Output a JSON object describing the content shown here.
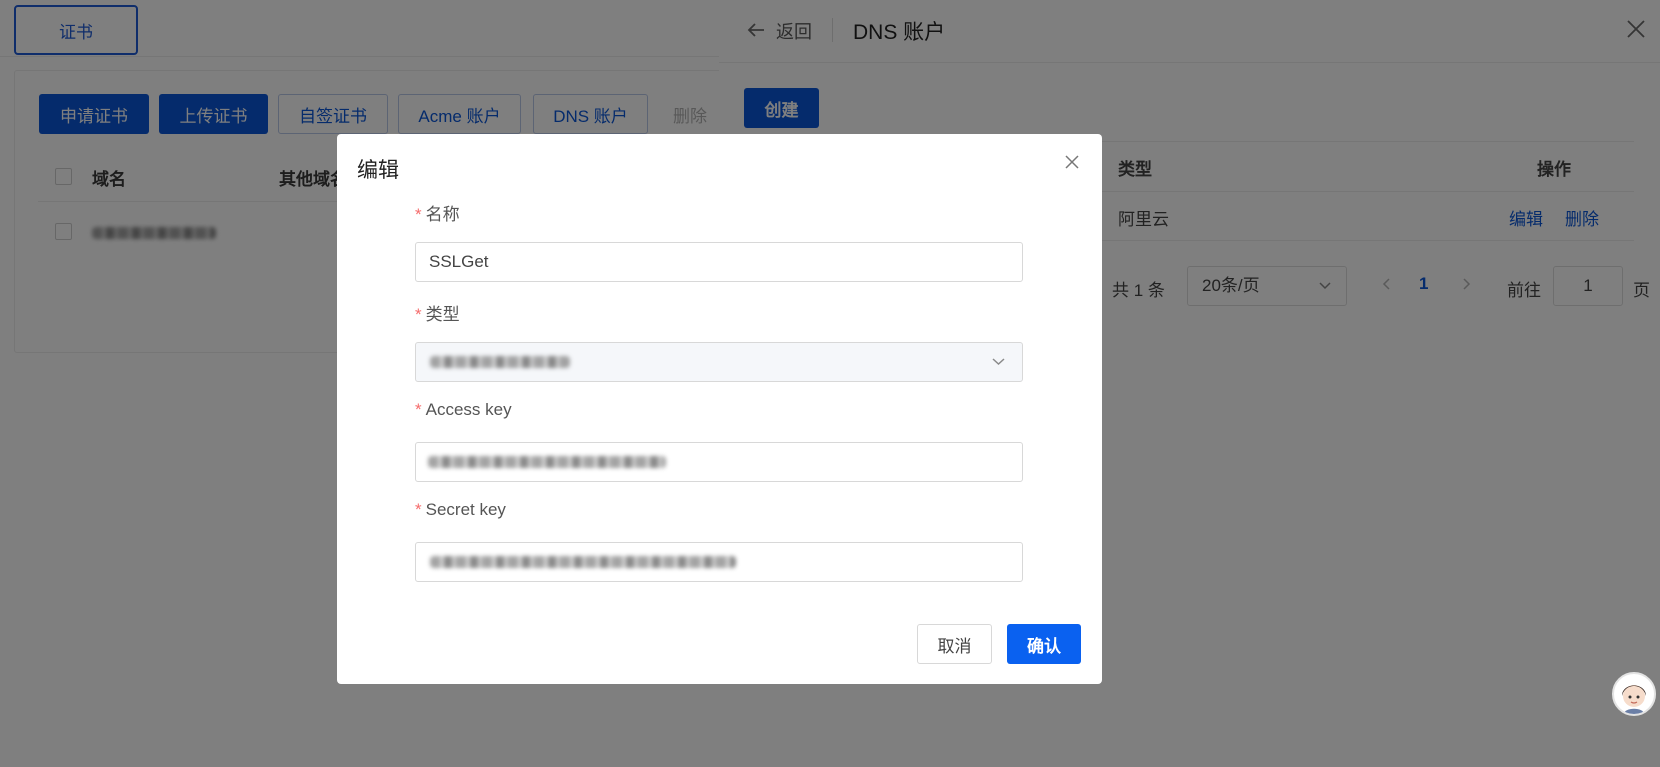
{
  "background": {
    "tab_label": "证书",
    "toolbar": {
      "apply_cert": "申请证书",
      "upload_cert": "上传证书",
      "self_signed": "自签证书",
      "acme_account": "Acme 账户",
      "dns_account": "DNS 账户",
      "delete": "删除"
    },
    "table": {
      "col_domain": "域名",
      "col_other": "其他域名"
    }
  },
  "drawer": {
    "back_label": "返回",
    "title": "DNS 账户",
    "create_label": "创建",
    "table": {
      "col_type": "类型",
      "col_actions": "操作",
      "rows": [
        {
          "type": "阿里云",
          "edit": "编辑",
          "delete": "删除"
        }
      ]
    },
    "pagination": {
      "total": "共 1 条",
      "page_size": "20条/页",
      "current_page": "1",
      "goto_label": "前往",
      "goto_value": "1",
      "page_suffix": "页"
    }
  },
  "dialog": {
    "title": "编辑",
    "fields": {
      "name_label": "名称",
      "name_value": "SSLGet",
      "type_label": "类型",
      "access_key_label": "Access key",
      "secret_key_label": "Secret key"
    },
    "cancel_label": "取消",
    "confirm_label": "确认"
  },
  "icons": {
    "back": "arrow-left-icon",
    "close": "close-icon",
    "chevron": "chevron-down-icon",
    "prev": "chevron-left-icon",
    "next": "chevron-right-icon"
  },
  "colors": {
    "primary": "#0a56d8",
    "confirm": "#0a61f0",
    "required": "#f56c6c"
  }
}
